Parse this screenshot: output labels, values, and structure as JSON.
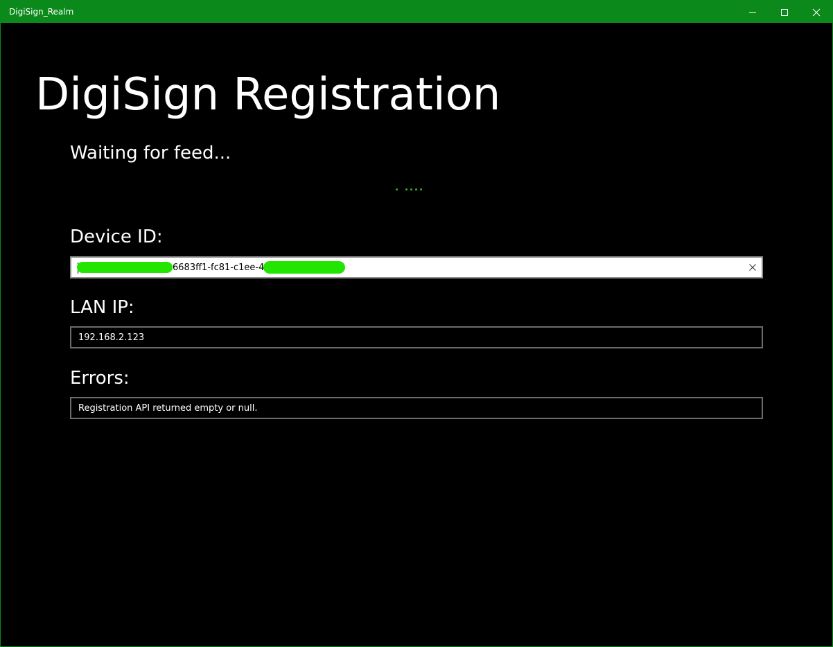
{
  "window": {
    "title": "DigiSign_Realm",
    "controls": {
      "minimize_icon": "minimize-icon",
      "maximize_icon": "maximize-icon",
      "close_icon": "close-icon"
    },
    "titlebar_color": "#0b8a1b"
  },
  "header": {
    "title": "DigiSign Registration",
    "status": "Waiting for feed..."
  },
  "progress": {
    "icon": "progress-dots",
    "color": "#36b02f"
  },
  "fields": {
    "device_id": {
      "label": "Device ID:",
      "value": "6683ff1-fc81-c1ee-40",
      "clear_icon": "clear-x-icon"
    },
    "lan_ip": {
      "label": "LAN IP:",
      "value": "192.168.2.123"
    },
    "errors": {
      "label": "Errors:",
      "value": "Registration API returned empty or null."
    }
  }
}
